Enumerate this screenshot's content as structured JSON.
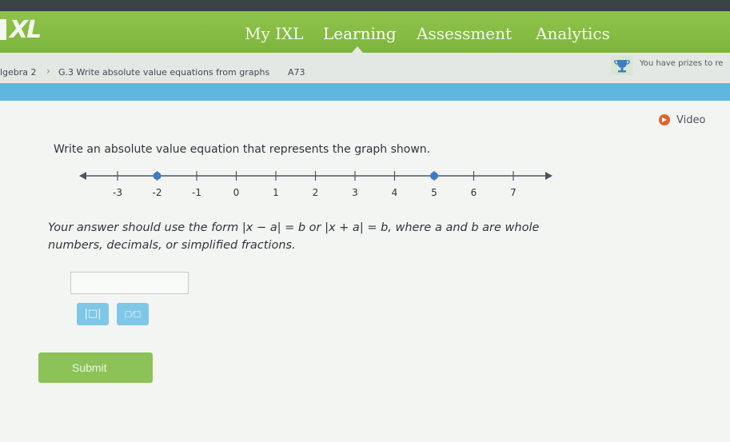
{
  "nav": {
    "logo": "XL",
    "items": [
      {
        "label": "My IXL"
      },
      {
        "label": "Learning"
      },
      {
        "label": "Assessment"
      },
      {
        "label": "Analytics"
      }
    ]
  },
  "breadcrumb": {
    "course": "lgebra 2",
    "separator": "›",
    "skill": "G.3 Write absolute value equations from graphs",
    "code": "A73"
  },
  "prize": {
    "text": "You have prizes to re"
  },
  "video": {
    "badge": "▶",
    "label": "Video"
  },
  "question": {
    "prompt": "Write an absolute value equation that represents the graph shown."
  },
  "number_line": {
    "ticks": [
      -3,
      -2,
      -1,
      0,
      1,
      2,
      3,
      4,
      5,
      6,
      7
    ],
    "tick_labels": [
      "-3",
      "-2",
      "-1",
      "0",
      "1",
      "2",
      "3",
      "4",
      "5",
      "6",
      "7"
    ],
    "points": [
      -2,
      5
    ],
    "point_color": "#3f7ac9"
  },
  "instructions": {
    "line1": "Your answer should use the form |x − a| = b or |x + a| = b, where a and b are whole",
    "line2": "numbers, decimals, or simplified fractions."
  },
  "answer": {
    "value": "",
    "placeholder": ""
  },
  "tools": {
    "abs_icon": "|□|",
    "fraction_icon": "□⁄□"
  },
  "submit": {
    "label": "Submit"
  }
}
